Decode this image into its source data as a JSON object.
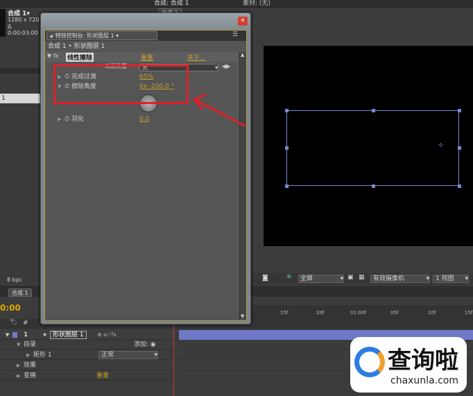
{
  "top": {
    "comp_viewer_tab": "合成: 合成 1",
    "footage_tab": "素材: (无)",
    "comp_sub_tab": "合成 1"
  },
  "project": {
    "comp_name": "合成 1▾",
    "resolution": "1280 x 720",
    "duration": "Δ 0:00:03:00",
    "bpc": "8 bpc",
    "item": "1"
  },
  "effects_panel": {
    "tab_title": "特效控制台: 形状图层 1",
    "breadcrumb": "合成 1 • 形状图层 1",
    "effect_name": "线性擦除",
    "reset": "重置",
    "about": "关于...",
    "dropdown_label": "动画预置",
    "dropdown_value": "无",
    "props": [
      {
        "label": "完成过渡",
        "value": "65%"
      },
      {
        "label": "擦除角度",
        "value": "0x -200.0 °"
      },
      {
        "label": "羽化",
        "value": "0.0"
      }
    ]
  },
  "viewer_toolbar": {
    "resolution": "全屏",
    "camera": "有效摄像机",
    "views": "1 视图"
  },
  "timeline": {
    "tab": "合成 1",
    "timecode": "0:00",
    "ruler": [
      "15f",
      "20f",
      "01:00f",
      "05f",
      "10f",
      "15f"
    ],
    "layer_num": "1",
    "layer_name": "形状图层 1",
    "rows": [
      {
        "label": "目录",
        "extra": "添加:"
      },
      {
        "label": "矩形 1",
        "extra": "正常"
      },
      {
        "label": "效果",
        "extra": ""
      },
      {
        "label": "变换",
        "extra": "重置"
      }
    ]
  },
  "watermark": {
    "text": "查询啦",
    "url": "chaxunla.com"
  },
  "colors": {
    "accent": "#c9a227",
    "highlight_box": "#e0202a",
    "layer_bar": "#6f79c8"
  }
}
